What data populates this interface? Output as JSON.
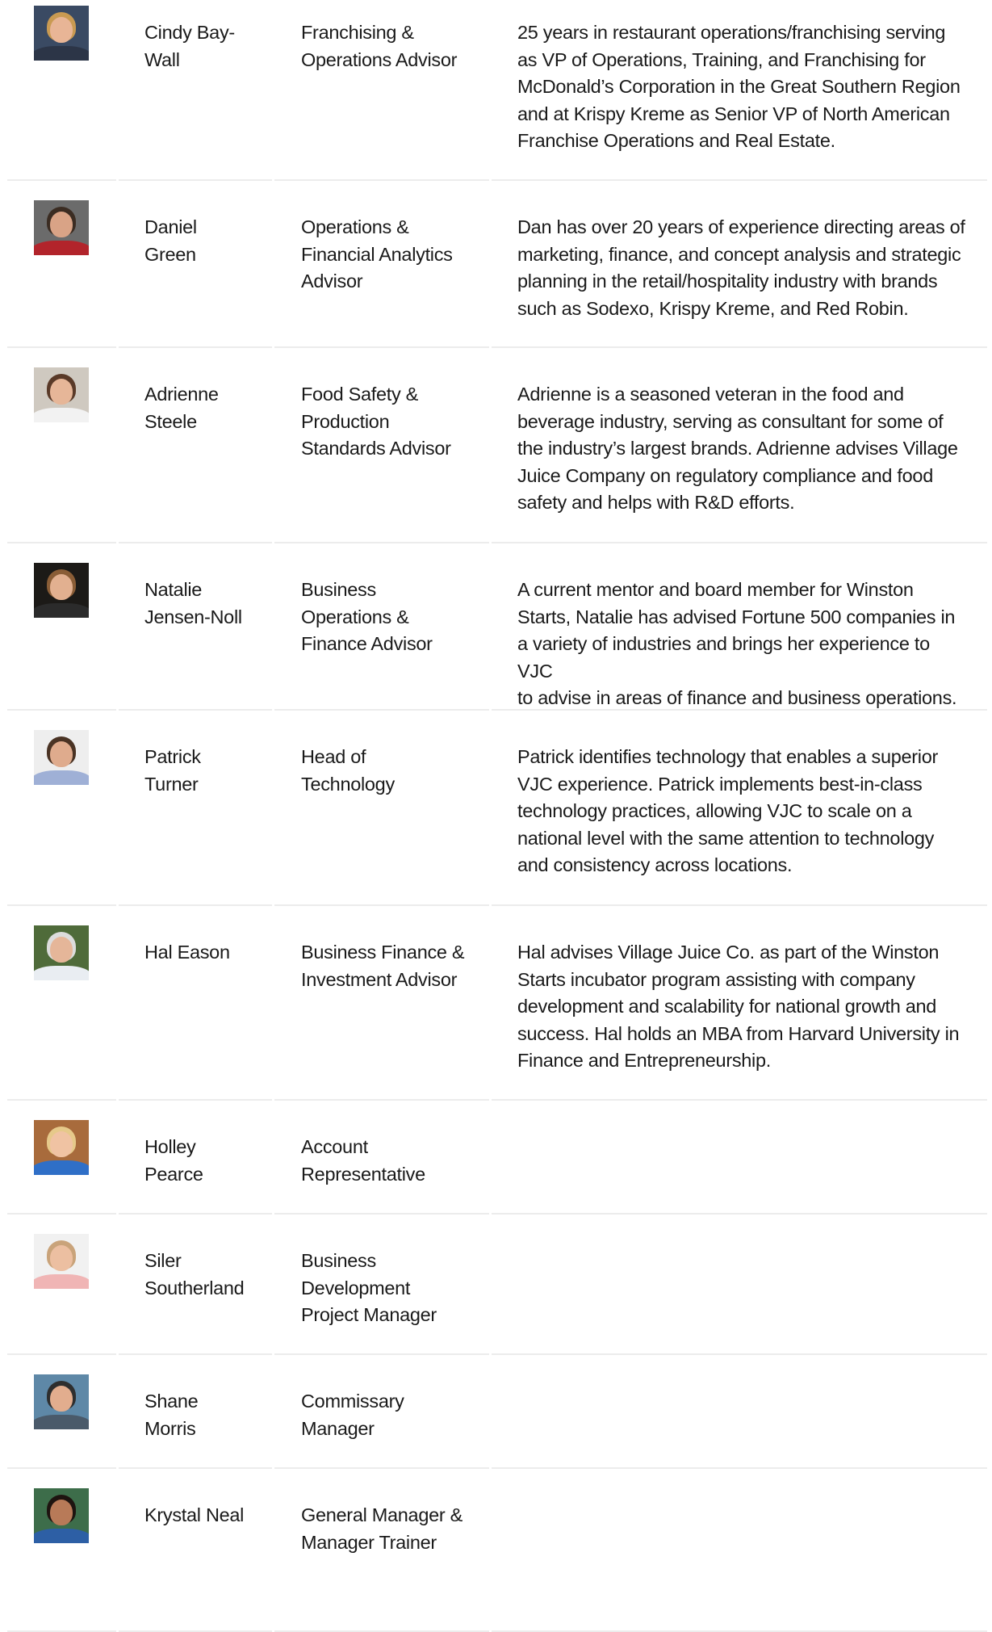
{
  "team": [
    {
      "name": "Cindy Bay-Wall",
      "name_lines": [
        "Cindy Bay-",
        "Wall"
      ],
      "title_lines": [
        "Franchising &",
        "Operations Advisor"
      ],
      "bio_lines": [
        "25 years in restaurant operations/franchising serving",
        "as VP of Operations, Training, and Franchising for",
        "McDonald’s Corporation in the Great Southern Region",
        "and at Krispy Kreme as Senior VP of North American",
        "Franchise Operations and Real Estate."
      ],
      "photo": {
        "bg": "#3a4a63",
        "skin": "#e8b596",
        "hair": "#c99a52",
        "shirt": "#2c3547"
      }
    },
    {
      "name": "Daniel Green",
      "name_lines": [
        "Daniel",
        "Green"
      ],
      "title_lines": [
        "Operations &",
        "Financial Analytics",
        "Advisor"
      ],
      "bio_lines": [
        "Dan has over 20 years of experience directing areas of",
        "marketing, finance, and concept analysis and strategic",
        "planning in the retail/hospitality industry with brands",
        "such as Sodexo, Krispy Kreme, and Red Robin."
      ],
      "photo": {
        "bg": "#6b6b6b",
        "skin": "#d9a386",
        "hair": "#3b2c22",
        "shirt": "#b2242b"
      }
    },
    {
      "name": "Adrienne Steele",
      "name_lines": [
        "Adrienne",
        "Steele"
      ],
      "title_lines": [
        "Food Safety &",
        "Production",
        "Standards Advisor"
      ],
      "bio_lines": [
        "Adrienne is a seasoned veteran in the food and",
        "beverage industry, serving as consultant for some of",
        "the industry’s largest brands. Adrienne advises Village",
        "Juice Company on regulatory compliance and food",
        "safety and helps with R&D efforts."
      ],
      "photo": {
        "bg": "#cfc9c0",
        "skin": "#e6b698",
        "hair": "#5a3a28",
        "shirt": "#f2f2f2"
      }
    },
    {
      "name": "Natalie Jensen-Noll",
      "name_lines": [
        "Natalie",
        "Jensen-Noll"
      ],
      "title_lines": [
        "Business",
        "Operations &",
        "Finance Advisor"
      ],
      "bio_lines": [
        "A current mentor and board member for Winston",
        "Starts, Natalie has advised Fortune 500 companies in",
        "a variety of industries and brings her experience to VJC",
        "to advise in areas of finance and business operations."
      ],
      "photo": {
        "bg": "#1c1a17",
        "skin": "#e2b090",
        "hair": "#8a5d36",
        "shirt": "#2b2b2b"
      }
    },
    {
      "name": "Patrick Turner",
      "name_lines": [
        "Patrick",
        "Turner"
      ],
      "title_lines": [
        "Head of",
        "Technology"
      ],
      "bio_lines": [
        "Patrick identifies technology that enables a superior",
        "VJC experience. Patrick implements best-in-class",
        "technology practices, allowing VJC to scale on a",
        "national level with the same attention to technology",
        "and consistency across locations."
      ],
      "photo": {
        "bg": "#eeeeee",
        "skin": "#dfab8d",
        "hair": "#4a3324",
        "shirt": "#9fb0d6"
      }
    },
    {
      "name": "Hal Eason",
      "name_lines": [
        "Hal Eason"
      ],
      "title_lines": [
        "Business Finance &",
        "Investment Advisor"
      ],
      "bio_lines": [
        "Hal advises Village Juice Co. as part of the Winston",
        "Starts incubator program assisting with company",
        "development and scalability for national growth and",
        "success. Hal holds an MBA from Harvard University in",
        "Finance and Entrepreneurship."
      ],
      "photo": {
        "bg": "#4f6b3a",
        "skin": "#e5b699",
        "hair": "#dcdcdc",
        "shirt": "#e9edf2"
      }
    },
    {
      "name": "Holley Pearce",
      "name_lines": [
        "Holley",
        "Pearce"
      ],
      "title_lines": [
        "Account",
        "Representative"
      ],
      "bio_lines": [],
      "photo": {
        "bg": "#a86b3c",
        "skin": "#f0c3a3",
        "hair": "#e6c98a",
        "shirt": "#2f6fc7"
      }
    },
    {
      "name": "Siler Southerland",
      "name_lines": [
        "Siler",
        "Southerland"
      ],
      "title_lines": [
        "Business",
        "Development",
        "Project Manager"
      ],
      "bio_lines": [],
      "photo": {
        "bg": "#f1f1f1",
        "skin": "#ecbfa1",
        "hair": "#c9a37a",
        "shirt": "#f0b5b5"
      }
    },
    {
      "name": "Shane Morris",
      "name_lines": [
        "Shane",
        "Morris"
      ],
      "title_lines": [
        "Commissary",
        "Manager"
      ],
      "bio_lines": [],
      "photo": {
        "bg": "#5e88a7",
        "skin": "#e2ad8e",
        "hair": "#2e2e2e",
        "shirt": "#4a5a6a"
      }
    },
    {
      "name": "Krystal Neal",
      "name_lines": [
        "Krystal Neal"
      ],
      "title_lines": [
        "General Manager &",
        "Manager Trainer"
      ],
      "bio_lines": [],
      "photo": {
        "bg": "#3d6d4a",
        "skin": "#b87a58",
        "hair": "#1e1410",
        "shirt": "#2d5fa5"
      }
    }
  ]
}
